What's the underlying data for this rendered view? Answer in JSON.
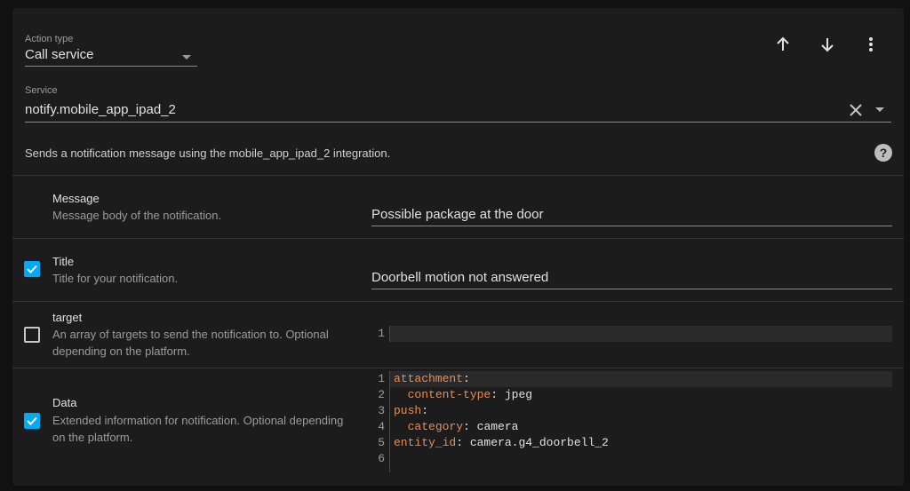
{
  "action_type": {
    "label": "Action type",
    "value": "Call service"
  },
  "toolbar": {
    "move_up_icon": "arrow-up-icon",
    "move_down_icon": "arrow-down-icon",
    "menu_icon": "more-vertical-icon"
  },
  "service": {
    "label": "Service",
    "value": "notify.mobile_app_ipad_2"
  },
  "description": "Sends a notification message using the mobile_app_ipad_2 integration.",
  "fields": {
    "message": {
      "name": "Message",
      "description": "Message body of the notification.",
      "value": "Possible package at the door"
    },
    "title": {
      "name": "Title",
      "description": "Title for your notification.",
      "value": "Doorbell motion not answered",
      "checked": true
    },
    "target": {
      "name": "target",
      "description": "An array of targets to send the notification to. Optional depending on the platform.",
      "checked": false,
      "line_numbers": [
        "1"
      ]
    },
    "data": {
      "name": "Data",
      "description": "Extended information for notification. Optional depending on the platform.",
      "checked": true,
      "line_numbers": [
        "1",
        "2",
        "3",
        "4",
        "5",
        "6"
      ],
      "code_lines": [
        {
          "key": "attachment",
          "colon": ":",
          "value": ""
        },
        {
          "indent": "  ",
          "key": "content-type",
          "colon": ":",
          "value": " jpeg"
        },
        {
          "key": "push",
          "colon": ":",
          "value": ""
        },
        {
          "indent": "  ",
          "key": "category",
          "colon": ":",
          "value": " camera"
        },
        {
          "key": "entity_id",
          "colon": ":",
          "value": " camera.g4_doorbell_2"
        },
        {
          "key": "",
          "colon": "",
          "value": ""
        }
      ]
    }
  },
  "colors": {
    "accent": "#03a9f4",
    "yaml_key": "#ee8a51"
  }
}
